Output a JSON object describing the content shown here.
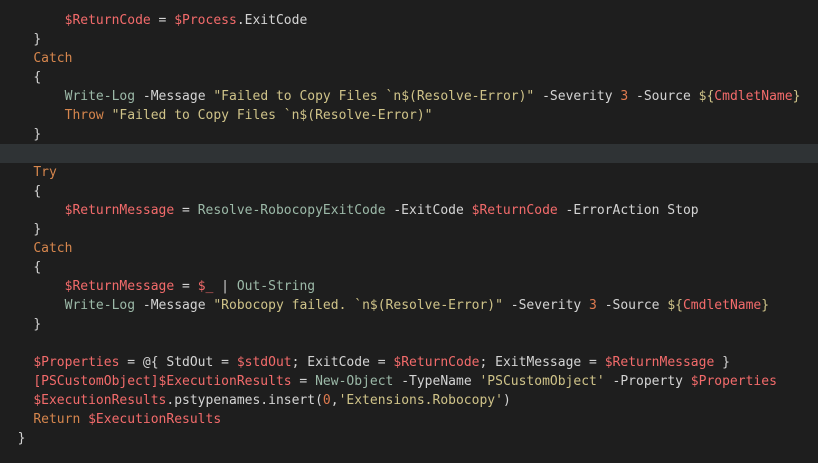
{
  "colors": {
    "background": "#1e1e1e",
    "current_line": "#2f3335",
    "variable": "#f36b6b",
    "keyword": "#d6864d",
    "string": "#cfc389",
    "command": "#9cb9a8",
    "text": "#d4d4d4",
    "number": "#e07b4f"
  },
  "code": {
    "lines": [
      {
        "indent": 8,
        "tokens": [
          [
            "var",
            "$ReturnCode"
          ],
          [
            "op",
            " = "
          ],
          [
            "var",
            "$Process"
          ],
          [
            "default",
            ".ExitCode"
          ]
        ]
      },
      {
        "indent": 4,
        "tokens": [
          [
            "brace",
            "}"
          ]
        ]
      },
      {
        "indent": 4,
        "tokens": [
          [
            "keyword",
            "Catch"
          ]
        ]
      },
      {
        "indent": 4,
        "tokens": [
          [
            "brace",
            "{"
          ]
        ]
      },
      {
        "indent": 8,
        "tokens": [
          [
            "cmd",
            "Write-Log"
          ],
          [
            "param",
            " -Message "
          ],
          [
            "string",
            "\"Failed to Copy Files `n$(Resolve-Error)\""
          ],
          [
            "param",
            " -Severity "
          ],
          [
            "number",
            "3"
          ],
          [
            "param",
            " -Source "
          ],
          [
            "string",
            "${"
          ],
          [
            "var",
            "CmdletName"
          ],
          [
            "string",
            "}"
          ]
        ]
      },
      {
        "indent": 8,
        "tokens": [
          [
            "keyword",
            "Throw"
          ],
          [
            "default",
            " "
          ],
          [
            "string",
            "\"Failed to Copy Files `n$(Resolve-Error)\""
          ]
        ]
      },
      {
        "indent": 4,
        "tokens": [
          [
            "brace",
            "}"
          ]
        ]
      },
      {
        "indent": 0,
        "tokens": [],
        "current": true
      },
      {
        "indent": 4,
        "tokens": [
          [
            "keyword",
            "Try"
          ]
        ]
      },
      {
        "indent": 4,
        "tokens": [
          [
            "brace",
            "{"
          ]
        ]
      },
      {
        "indent": 8,
        "tokens": [
          [
            "var",
            "$ReturnMessage"
          ],
          [
            "op",
            " = "
          ],
          [
            "cmd",
            "Resolve-RobocopyExitCode"
          ],
          [
            "param",
            " -ExitCode "
          ],
          [
            "var",
            "$ReturnCode"
          ],
          [
            "param",
            " -ErrorAction Stop"
          ]
        ]
      },
      {
        "indent": 4,
        "tokens": [
          [
            "brace",
            "}"
          ]
        ]
      },
      {
        "indent": 4,
        "tokens": [
          [
            "keyword",
            "Catch"
          ]
        ]
      },
      {
        "indent": 4,
        "tokens": [
          [
            "brace",
            "{"
          ]
        ]
      },
      {
        "indent": 8,
        "tokens": [
          [
            "var",
            "$ReturnMessage"
          ],
          [
            "op",
            " = "
          ],
          [
            "var",
            "$_"
          ],
          [
            "op",
            " | "
          ],
          [
            "cmd",
            "Out-String"
          ]
        ]
      },
      {
        "indent": 8,
        "tokens": [
          [
            "cmd",
            "Write-Log"
          ],
          [
            "param",
            " -Message "
          ],
          [
            "string",
            "\"Robocopy failed. `n$(Resolve-Error)\""
          ],
          [
            "param",
            " -Severity "
          ],
          [
            "number",
            "3"
          ],
          [
            "param",
            " -Source "
          ],
          [
            "string",
            "${"
          ],
          [
            "var",
            "CmdletName"
          ],
          [
            "string",
            "}"
          ]
        ]
      },
      {
        "indent": 4,
        "tokens": [
          [
            "brace",
            "}"
          ]
        ]
      },
      {
        "indent": 0,
        "tokens": []
      },
      {
        "indent": 4,
        "tokens": [
          [
            "var",
            "$Properties"
          ],
          [
            "op",
            " = @{ "
          ],
          [
            "default",
            "StdOut"
          ],
          [
            "op",
            " = "
          ],
          [
            "var",
            "$stdOut"
          ],
          [
            "op",
            "; "
          ],
          [
            "default",
            "ExitCode"
          ],
          [
            "op",
            " = "
          ],
          [
            "var",
            "$ReturnCode"
          ],
          [
            "op",
            "; "
          ],
          [
            "default",
            "ExitMessage"
          ],
          [
            "op",
            " = "
          ],
          [
            "var",
            "$ReturnMessage"
          ],
          [
            "op",
            " }"
          ]
        ]
      },
      {
        "indent": 4,
        "tokens": [
          [
            "type",
            "[PSCustomObject]"
          ],
          [
            "var",
            "$ExecutionResults"
          ],
          [
            "op",
            " = "
          ],
          [
            "cmd",
            "New-Object"
          ],
          [
            "param",
            " -TypeName "
          ],
          [
            "string",
            "'PSCustomObject'"
          ],
          [
            "param",
            " -Property "
          ],
          [
            "var",
            "$Properties"
          ]
        ]
      },
      {
        "indent": 4,
        "tokens": [
          [
            "var",
            "$ExecutionResults"
          ],
          [
            "default",
            ".pstypenames.insert("
          ],
          [
            "number",
            "0"
          ],
          [
            "default",
            ","
          ],
          [
            "string",
            "'Extensions.Robocopy'"
          ],
          [
            "default",
            ")"
          ]
        ]
      },
      {
        "indent": 4,
        "tokens": [
          [
            "keyword",
            "Return"
          ],
          [
            "default",
            " "
          ],
          [
            "var",
            "$ExecutionResults"
          ]
        ]
      },
      {
        "indent": 2,
        "tokens": [
          [
            "brace",
            "}"
          ]
        ]
      }
    ]
  }
}
